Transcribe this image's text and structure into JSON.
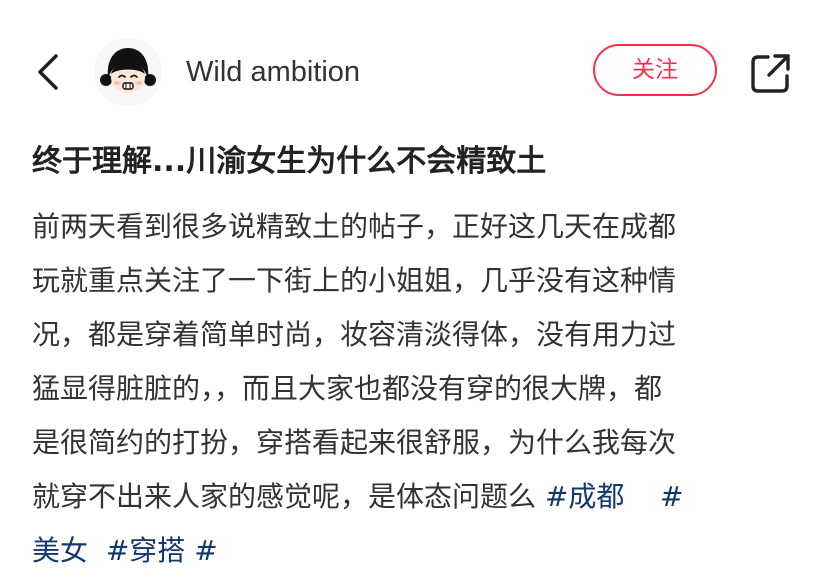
{
  "header": {
    "username": "Wild ambition",
    "follow_label": "关注"
  },
  "post": {
    "title": "终于理解...川渝女生为什么不会精致土",
    "body_lines": [
      "前两天看到很多说精致土的帖子，正好这几天在成都",
      "玩就重点关注了一下街上的小姐姐，几乎没有这种情",
      "况，都是穿着简单时尚，妆容清淡得体，没有用力过",
      "猛显得脏脏的，，而且大家也都没有穿的很大牌，都",
      "是很简约的打扮，穿搭看起来很舒服，为什么我每次",
      "就穿不出来人家的感觉呢，是体态问题么 "
    ],
    "tags": [
      "#成都",
      "#",
      "美女",
      "#穿搭",
      "#"
    ]
  },
  "colors": {
    "accent": "#ff2e4d",
    "tag": "#13386c",
    "text": "#333333"
  },
  "icons": {
    "back": "chevron-left-icon",
    "share": "share-external-icon"
  }
}
